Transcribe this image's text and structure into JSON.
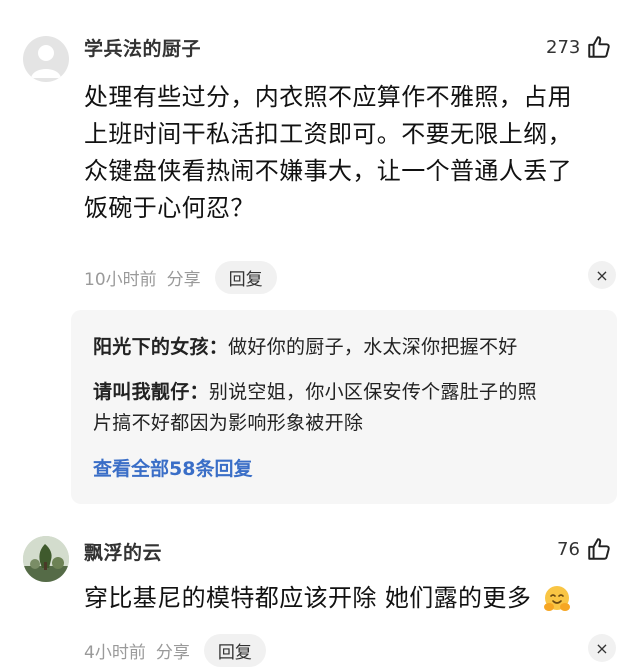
{
  "comments": [
    {
      "username": "学兵法的厨子",
      "likes": "273",
      "text_lines": [
        "处理有些过分，内衣照不应算作不雅照，占用",
        "上班时间干私活扣工资即可。不要无限上纲，",
        "众键盘侠看热闹不嫌事大，让一个普通人丢了",
        "饭碗于心何忍？"
      ],
      "time": "10小时前",
      "share": "分享",
      "reply": "回复",
      "close": "×",
      "replies": [
        {
          "name": "阳光下的女孩：",
          "lines": [
            "做好你的厨子，水太深你把握不好"
          ]
        },
        {
          "name": "请叫我靓仔：",
          "lines": [
            "别说空姐，你小区保安传个露肚子的照",
            "片搞不好都因为影响形象被开除"
          ]
        }
      ],
      "more_replies": "查看全部58条回复"
    },
    {
      "username": "飘浮的云",
      "likes": "76",
      "text": "穿比基尼的模特都应该开除 她们露的更多",
      "time": "4小时前",
      "share": "分享",
      "reply": "回复",
      "close": "×"
    }
  ],
  "icons": {
    "like": "thumbs-up-icon",
    "emoji": "hugging-face-emoji-icon",
    "close": "close-icon"
  },
  "colors": {
    "link": "#3a6ec7",
    "meta": "#9a9a9a",
    "reply_box": "#f6f6f6"
  }
}
